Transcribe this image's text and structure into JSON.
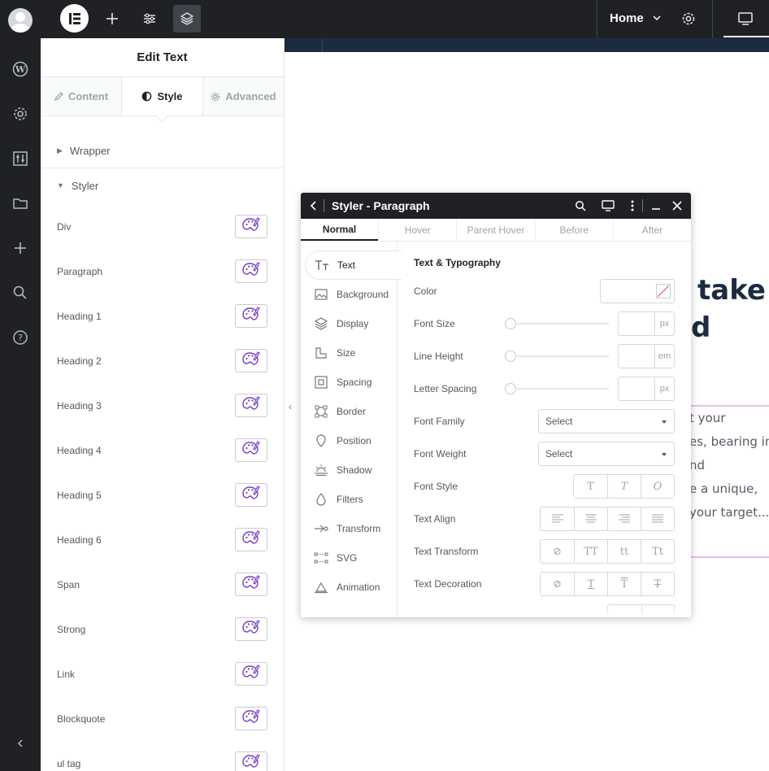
{
  "topbar": {
    "home_label": "Home"
  },
  "panel": {
    "title": "Edit Text",
    "tabs": [
      {
        "label": "Content",
        "icon": "pencil-icon"
      },
      {
        "label": "Style",
        "icon": "half-circle-icon"
      },
      {
        "label": "Advanced",
        "icon": "gear-icon"
      }
    ],
    "sections": {
      "wrapper": "Wrapper",
      "styler": "Styler"
    },
    "styler_items": [
      "Div",
      "Paragraph",
      "Heading 1",
      "Heading 2",
      "Heading 3",
      "Heading 4",
      "Heading 5",
      "Heading 6",
      "Span",
      "Strong",
      "Link",
      "Blockquote",
      "ul tag"
    ]
  },
  "dialog": {
    "title": "Styler - Paragraph",
    "states": [
      "Normal",
      "Hover",
      "Parent Hover",
      "Before",
      "After"
    ],
    "categories": [
      "Text",
      "Background",
      "Display",
      "Size",
      "Spacing",
      "Border",
      "Position",
      "Shadow",
      "Filters",
      "Transform",
      "SVG",
      "Animation"
    ],
    "section_title": "Text & Typography",
    "props": {
      "color": "Color",
      "font_size": "Font Size",
      "font_size_unit": "px",
      "line_height": "Line Height",
      "line_height_unit": "em",
      "letter_spacing": "Letter Spacing",
      "letter_spacing_unit": "px",
      "font_family": "Font Family",
      "font_family_value": "Select",
      "font_weight": "Font Weight",
      "font_weight_value": "Select",
      "font_style": "Font Style",
      "font_style_options": [
        "T",
        "T",
        "O"
      ],
      "text_align": "Text Align",
      "text_transform": "Text Transform",
      "text_transform_options": [
        "⊘",
        "TT",
        "tt",
        "Tt"
      ],
      "text_decoration": "Text Decoration",
      "text_decoration_options": [
        "⊘",
        "T",
        "T",
        "T"
      ]
    }
  },
  "preview": {
    "heading_lines": [
      "take",
      "d"
    ],
    "paragraph_lines": [
      "t your",
      "es, bearing in",
      "nd",
      "e a unique,",
      " your target..."
    ]
  },
  "colors": {
    "dark": "#1f2124",
    "navy": "#1c2b3f",
    "accent_purple": "#7a3ec1",
    "selection_pink": "#e4bfe6"
  }
}
